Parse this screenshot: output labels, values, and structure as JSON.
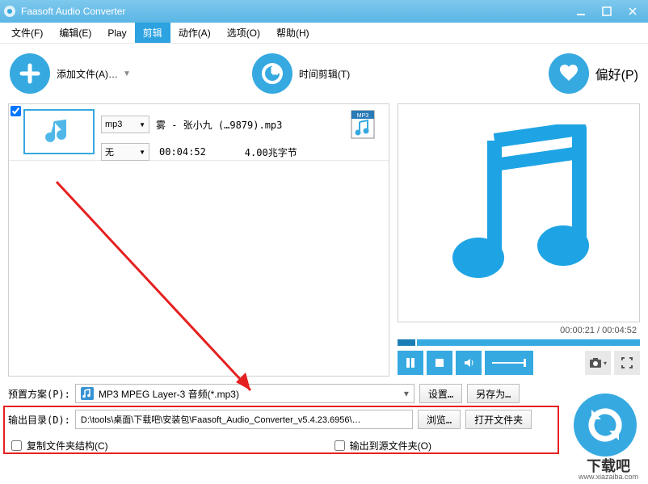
{
  "window": {
    "title": "Faasoft Audio Converter"
  },
  "menu": {
    "file": "文件(F)",
    "edit": "编辑(E)",
    "play": "Play",
    "trim": "剪辑",
    "action": "动作(A)",
    "option": "选项(O)",
    "help": "帮助(H)"
  },
  "toolbar": {
    "add_file": "添加文件(A)…",
    "time_trim": "时间剪辑(T)",
    "preference": "偏好(P)"
  },
  "file_item": {
    "format_sel": "mp3",
    "channel_sel": "无",
    "name": "雾 - 张小九 (…9879).mp3",
    "duration": "00:04:52",
    "size": "4.00兆字节",
    "badge": "MP3"
  },
  "player": {
    "time_current": "00:00:21",
    "time_sep": " / ",
    "time_total": "00:04:52"
  },
  "bottom": {
    "preset_label": "预置方案(P):",
    "preset_value": "MP3 MPEG Layer-3 音频(*.mp3)",
    "btn_settings": "设置…",
    "btn_saveas": "另存为…",
    "output_label": "输出目录(D):",
    "output_path": "D:\\tools\\桌面\\下载吧\\安装包\\Faasoft_Audio_Converter_v5.4.23.6956\\…",
    "btn_browse": "浏览…",
    "btn_openfolder": "打开文件夹",
    "chk_copy_structure": "复制文件夹结构(C)",
    "chk_output_to_source": "输出到源文件夹(O)"
  },
  "watermark": {
    "main": "下载吧",
    "sub": "www.xiazaiba.com"
  }
}
